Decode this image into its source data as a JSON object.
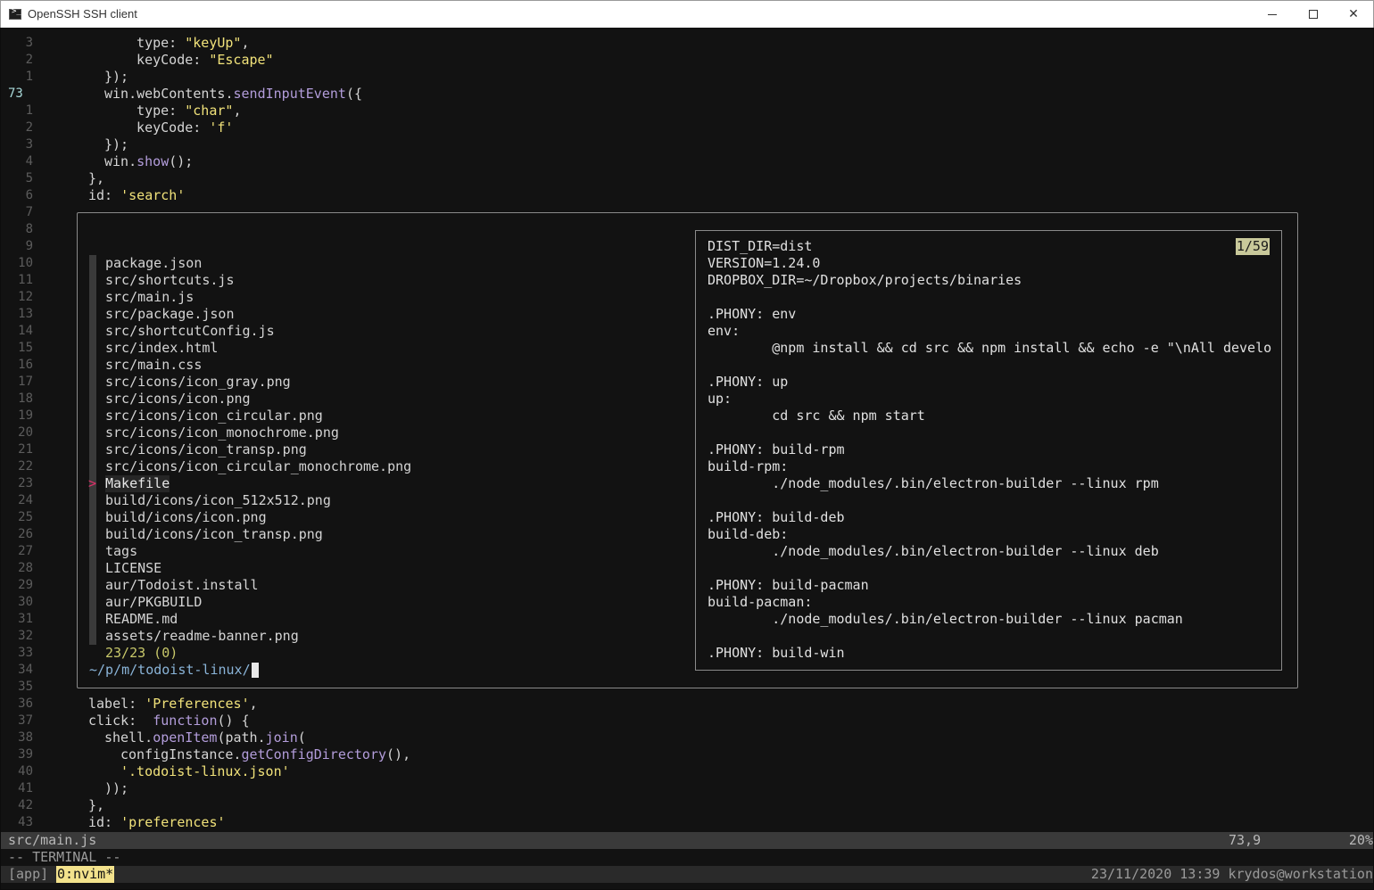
{
  "window": {
    "title": "OpenSSH SSH client",
    "minimize_glyph": "—",
    "close_glyph": "✕"
  },
  "editor": {
    "lines_top": [
      {
        "num": "3",
        "code": [
          [
            "",
            "  type: "
          ],
          [
            "str",
            "\"keyUp\""
          ],
          [
            "",
            ","
          ]
        ],
        "indent": 36
      },
      {
        "num": "2",
        "code": [
          [
            "",
            "  keyCode: "
          ],
          [
            "str",
            "\"Escape\""
          ]
        ],
        "indent": 36
      },
      {
        "num": "1",
        "code": [
          [
            "",
            "});"
          ]
        ],
        "indent": 18
      },
      {
        "num": "73",
        "cur": true,
        "code": [
          [
            "",
            "win.webContents."
          ],
          [
            "fn",
            "sendInputEvent"
          ],
          [
            "",
            "({"
          ]
        ],
        "indent": 18
      },
      {
        "num": "1",
        "code": [
          [
            "",
            "  type: "
          ],
          [
            "str",
            "\"char\""
          ],
          [
            "",
            ","
          ]
        ],
        "indent": 36
      },
      {
        "num": "2",
        "code": [
          [
            "",
            "  keyCode: "
          ],
          [
            "str",
            "'f'"
          ]
        ],
        "indent": 36
      },
      {
        "num": "3",
        "code": [
          [
            "",
            "});"
          ]
        ],
        "indent": 18
      },
      {
        "num": "4",
        "code": [
          [
            "",
            "win."
          ],
          [
            "fn",
            "show"
          ],
          [
            "",
            "();"
          ]
        ],
        "indent": 18
      },
      {
        "num": "5",
        "code": [
          [
            "",
            "},"
          ]
        ],
        "indent": 0
      },
      {
        "num": "6",
        "code": [
          [
            "",
            "id: "
          ],
          [
            "str",
            "'search'"
          ]
        ],
        "indent": 0
      },
      {
        "num": "7",
        "code": [],
        "indent": 0
      },
      {
        "num": "8",
        "code": [],
        "indent": 0
      },
      {
        "num": "9",
        "code": [],
        "indent": 0
      }
    ],
    "lines_mid_nums": [
      "10",
      "11",
      "12",
      "13",
      "14",
      "15",
      "16",
      "17",
      "18",
      "19",
      "20",
      "21",
      "22",
      "23",
      "24",
      "25",
      "26",
      "27",
      "28",
      "29",
      "30",
      "31",
      "32",
      "33",
      "34",
      "35"
    ],
    "lines_bottom": [
      {
        "num": "36",
        "code": [
          [
            "",
            "label: "
          ],
          [
            "str",
            "'Preferences'"
          ],
          [
            "",
            ","
          ]
        ],
        "indent": 0
      },
      {
        "num": "37",
        "code": [
          [
            "",
            "click:  "
          ],
          [
            "kw",
            "function"
          ],
          [
            "",
            "() {"
          ]
        ],
        "indent": 0
      },
      {
        "num": "38",
        "code": [
          [
            "",
            "shell."
          ],
          [
            "fn",
            "openItem"
          ],
          [
            "",
            "(path."
          ],
          [
            "fn",
            "join"
          ],
          [
            "",
            "("
          ]
        ],
        "indent": 18
      },
      {
        "num": "39",
        "code": [
          [
            "",
            "configInstance."
          ],
          [
            "fn",
            "getConfigDirectory"
          ],
          [
            "",
            "(),"
          ]
        ],
        "indent": 36
      },
      {
        "num": "40",
        "code": [
          [
            "str",
            "'.todoist-linux.json'"
          ]
        ],
        "indent": 36
      },
      {
        "num": "41",
        "code": [
          [
            "",
            "));"
          ]
        ],
        "indent": 18
      },
      {
        "num": "42",
        "code": [
          [
            "",
            "},"
          ]
        ],
        "indent": 0
      },
      {
        "num": "43",
        "code": [
          [
            "",
            "id: "
          ],
          [
            "str",
            "'preferences'"
          ]
        ],
        "indent": 0
      }
    ]
  },
  "finder": {
    "files": [
      "package.json",
      "src/shortcuts.js",
      "src/main.js",
      "src/package.json",
      "src/shortcutConfig.js",
      "src/index.html",
      "src/main.css",
      "src/icons/icon_gray.png",
      "src/icons/icon.png",
      "src/icons/icon_circular.png",
      "src/icons/icon_monochrome.png",
      "src/icons/icon_transp.png",
      "src/icons/icon_circular_monochrome.png",
      "Makefile",
      "build/icons/icon_512x512.png",
      "build/icons/icon.png",
      "build/icons/icon_transp.png",
      "tags",
      "LICENSE",
      "aur/Todoist.install",
      "aur/PKGBUILD",
      "README.md",
      "assets/readme-banner.png"
    ],
    "selected_index": 13,
    "pointer": ">",
    "count": "23/23 (0)",
    "prompt": "~/p/m/todoist-linux/"
  },
  "preview": {
    "counter": "1/59",
    "lines": [
      "DIST_DIR=dist",
      "VERSION=1.24.0",
      "DROPBOX_DIR=~/Dropbox/projects/binaries",
      "",
      ".PHONY: env",
      "env:",
      "        @npm install && cd src && npm install && echo -e \"\\nAll develo",
      "",
      ".PHONY: up",
      "up:",
      "        cd src && npm start",
      "",
      ".PHONY: build-rpm",
      "build-rpm:",
      "        ./node_modules/.bin/electron-builder --linux rpm",
      "",
      ".PHONY: build-deb",
      "build-deb:",
      "        ./node_modules/.bin/electron-builder --linux deb",
      "",
      ".PHONY: build-pacman",
      "build-pacman:",
      "        ./node_modules/.bin/electron-builder --linux pacman",
      "",
      ".PHONY: build-win"
    ]
  },
  "status": {
    "file": "src/main.js",
    "position": "73,9",
    "percent": "20%"
  },
  "mode": "-- TERMINAL --",
  "tmux": {
    "session": "[app]",
    "window": "0:nvim*",
    "right": "23/11/2020 13:39 krydos@workstation"
  }
}
